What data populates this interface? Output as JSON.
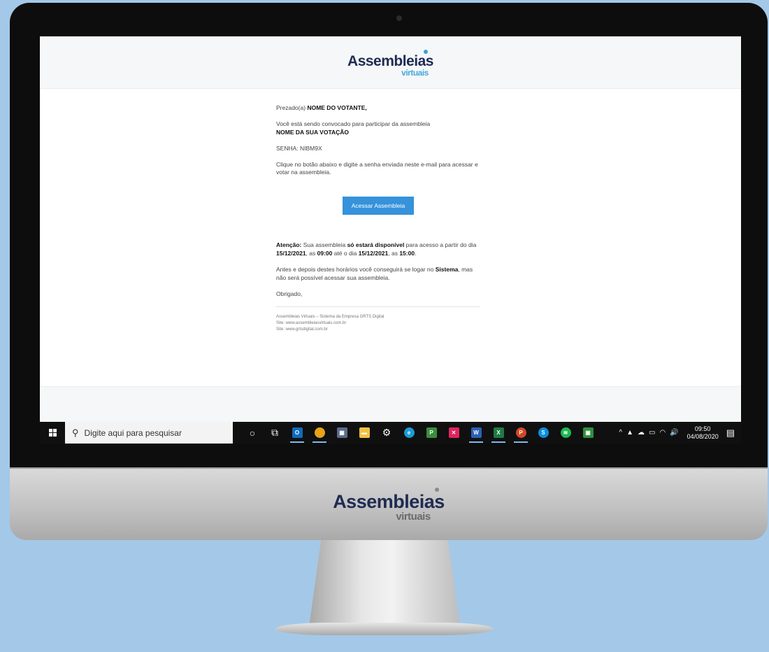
{
  "brand": {
    "name": "Assembleias",
    "sub": "virtuais"
  },
  "email": {
    "greeting_prefix": "Prezado(a)",
    "voter_name": "NOME DO VOTANTE,",
    "invite_text": "Você está sendo convocado para participar da assembleia",
    "assembly_name": "NOME DA SUA VOTAÇÃO",
    "password_line": "SENHA: NIBM9X",
    "instruction": "Clique no botão abaixo e digite a senha enviada neste e-mail para acessar e votar na assembleia.",
    "button_label": "Acessar Assembleia",
    "attention_label": "Atenção:",
    "attention_text1": " Sua assembleia ",
    "attention_bold1": "só estará disponível",
    "attention_text2": " para acesso a partir do dia ",
    "start_date": "15/12/2021",
    "attention_text3": ", as ",
    "start_time": "09:00",
    "attention_text4": " até o dia ",
    "end_date": "15/12/2021",
    "attention_text5": ", as ",
    "end_time": "15:00",
    "attention_text6": ".",
    "note_text1": "Antes e depois destes horários você conseguirá se logar no ",
    "note_bold": "Sistema",
    "note_text2": ", mas não será possível acessar sua assembleia.",
    "thanks": "Obrigado,",
    "footer_lines": [
      "Assembleias Virtuais – Sistema da Empresa GRTS Digital",
      "Site: www.assembleiasvirtuais.com.br",
      "Site: www.grtsdigital.com.br"
    ]
  },
  "taskbar": {
    "search_placeholder": "Digite aqui para pesquisar",
    "icons": [
      {
        "name": "cortana-icon",
        "glyph": "○",
        "color": ""
      },
      {
        "name": "task-view-icon",
        "glyph": "⧉",
        "color": ""
      },
      {
        "name": "outlook-icon",
        "glyph": "O",
        "color": "#0f6cbd"
      },
      {
        "name": "chrome-icon",
        "glyph": "",
        "color": "#e8a317"
      },
      {
        "name": "calculator-icon",
        "glyph": "▦",
        "color": "#5b6b8c"
      },
      {
        "name": "file-explorer-icon",
        "glyph": "▬",
        "color": "#f2c343"
      },
      {
        "name": "settings-icon",
        "glyph": "⚙",
        "color": ""
      },
      {
        "name": "edge-icon",
        "glyph": "e",
        "color": "#1a9bd8"
      },
      {
        "name": "project-icon",
        "glyph": "P",
        "color": "#3a8e3e"
      },
      {
        "name": "xmind-icon",
        "glyph": "✕",
        "color": "#e0245e"
      },
      {
        "name": "word-icon",
        "glyph": "W",
        "color": "#2b5fb4"
      },
      {
        "name": "excel-icon",
        "glyph": "X",
        "color": "#1f7a44"
      },
      {
        "name": "powerpoint-icon",
        "glyph": "P",
        "color": "#d24726"
      },
      {
        "name": "skype-icon",
        "glyph": "S",
        "color": "#0c8de0"
      },
      {
        "name": "spotify-icon",
        "glyph": "≋",
        "color": "#1db954"
      },
      {
        "name": "app-icon",
        "glyph": "▣",
        "color": "#2f8f3f"
      }
    ],
    "tray_icons": [
      "^",
      "▲",
      "☁",
      "▭",
      "◠",
      "🔊"
    ],
    "time": "09:50",
    "date": "04/08/2020"
  }
}
